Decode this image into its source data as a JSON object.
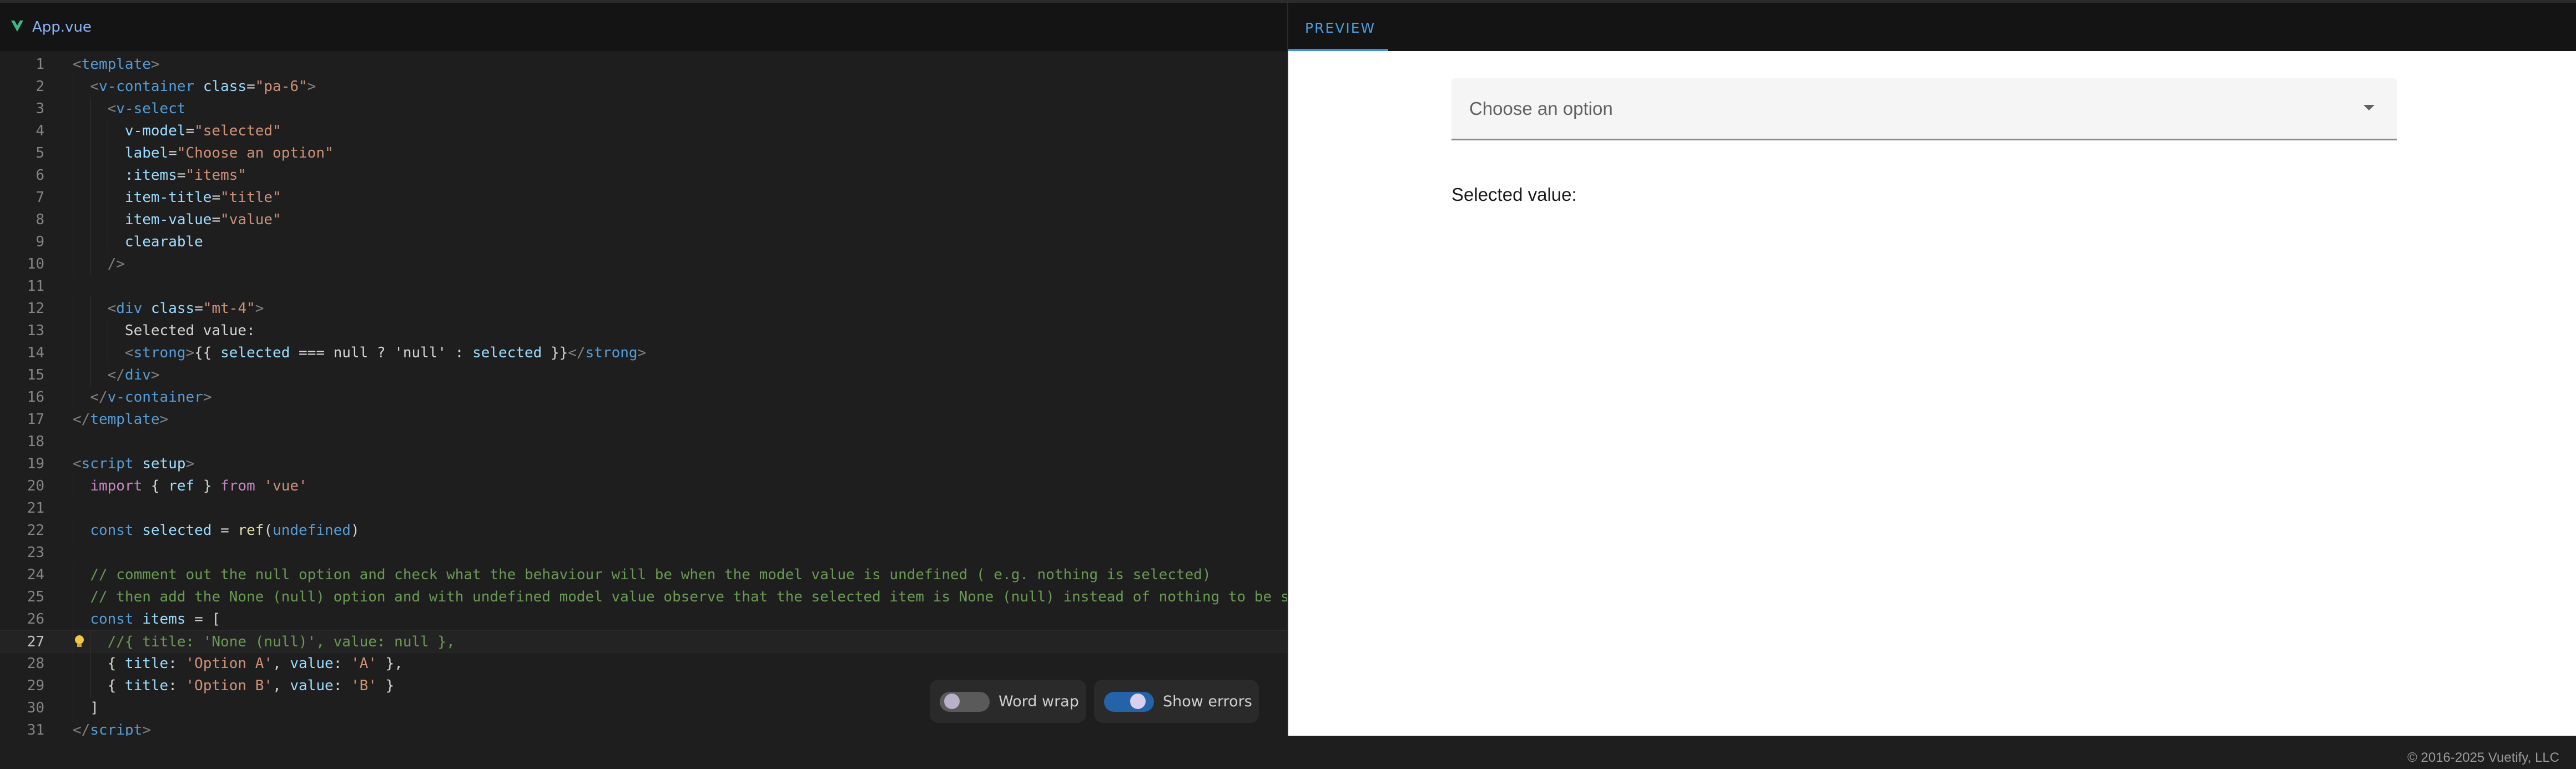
{
  "editor": {
    "file_tab": "App.vue",
    "lines": [
      {
        "n": "1",
        "tokens": [
          [
            "bkt",
            "<"
          ],
          [
            "tag",
            "template"
          ],
          [
            "bkt",
            ">"
          ]
        ]
      },
      {
        "n": "2",
        "tokens": [
          [
            "txt",
            "  "
          ],
          [
            "bkt",
            "<"
          ],
          [
            "tag",
            "v-container"
          ],
          [
            "txt",
            " "
          ],
          [
            "attr",
            "class"
          ],
          [
            "txt",
            "="
          ],
          [
            "str",
            "\"pa-6\""
          ],
          [
            "bkt",
            ">"
          ]
        ]
      },
      {
        "n": "3",
        "tokens": [
          [
            "txt",
            "    "
          ],
          [
            "bkt",
            "<"
          ],
          [
            "tag",
            "v-select"
          ]
        ]
      },
      {
        "n": "4",
        "tokens": [
          [
            "txt",
            "      "
          ],
          [
            "attr",
            "v-model"
          ],
          [
            "txt",
            "="
          ],
          [
            "str",
            "\"selected\""
          ]
        ]
      },
      {
        "n": "5",
        "tokens": [
          [
            "txt",
            "      "
          ],
          [
            "attr",
            "label"
          ],
          [
            "txt",
            "="
          ],
          [
            "str",
            "\"Choose an option\""
          ]
        ]
      },
      {
        "n": "6",
        "tokens": [
          [
            "txt",
            "      "
          ],
          [
            "attr",
            ":items"
          ],
          [
            "txt",
            "="
          ],
          [
            "str",
            "\"items\""
          ]
        ]
      },
      {
        "n": "7",
        "tokens": [
          [
            "txt",
            "      "
          ],
          [
            "attr",
            "item-title"
          ],
          [
            "txt",
            "="
          ],
          [
            "str",
            "\"title\""
          ]
        ]
      },
      {
        "n": "8",
        "tokens": [
          [
            "txt",
            "      "
          ],
          [
            "attr",
            "item-value"
          ],
          [
            "txt",
            "="
          ],
          [
            "str",
            "\"value\""
          ]
        ]
      },
      {
        "n": "9",
        "tokens": [
          [
            "txt",
            "      "
          ],
          [
            "attr",
            "clearable"
          ]
        ]
      },
      {
        "n": "10",
        "tokens": [
          [
            "txt",
            "    "
          ],
          [
            "bkt",
            "/>"
          ]
        ]
      },
      {
        "n": "11",
        "tokens": []
      },
      {
        "n": "12",
        "tokens": [
          [
            "txt",
            "    "
          ],
          [
            "bkt",
            "<"
          ],
          [
            "tag",
            "div"
          ],
          [
            "txt",
            " "
          ],
          [
            "attr",
            "class"
          ],
          [
            "txt",
            "="
          ],
          [
            "str",
            "\"mt-4\""
          ],
          [
            "bkt",
            ">"
          ]
        ]
      },
      {
        "n": "13",
        "tokens": [
          [
            "txt",
            "      Selected value:"
          ]
        ]
      },
      {
        "n": "14",
        "tokens": [
          [
            "txt",
            "      "
          ],
          [
            "bkt",
            "<"
          ],
          [
            "tag",
            "strong"
          ],
          [
            "bkt",
            ">"
          ],
          [
            "txt",
            "{{ "
          ],
          [
            "var",
            "selected"
          ],
          [
            "txt",
            " === null ? 'null' : "
          ],
          [
            "var",
            "selected"
          ],
          [
            "txt",
            " }}"
          ],
          [
            "bkt",
            "</"
          ],
          [
            "tag",
            "strong"
          ],
          [
            "bkt",
            ">"
          ]
        ]
      },
      {
        "n": "15",
        "tokens": [
          [
            "txt",
            "    "
          ],
          [
            "bkt",
            "</"
          ],
          [
            "tag",
            "div"
          ],
          [
            "bkt",
            ">"
          ]
        ]
      },
      {
        "n": "16",
        "tokens": [
          [
            "txt",
            "  "
          ],
          [
            "bkt",
            "</"
          ],
          [
            "tag",
            "v-container"
          ],
          [
            "bkt",
            ">"
          ]
        ]
      },
      {
        "n": "17",
        "tokens": [
          [
            "bkt",
            "</"
          ],
          [
            "tag",
            "template"
          ],
          [
            "bkt",
            ">"
          ]
        ]
      },
      {
        "n": "18",
        "tokens": []
      },
      {
        "n": "19",
        "tokens": [
          [
            "bkt",
            "<"
          ],
          [
            "tag",
            "script"
          ],
          [
            "txt",
            " "
          ],
          [
            "attr",
            "setup"
          ],
          [
            "bkt",
            ">"
          ]
        ]
      },
      {
        "n": "20",
        "tokens": [
          [
            "txt",
            "  "
          ],
          [
            "kw",
            "import"
          ],
          [
            "txt",
            " { "
          ],
          [
            "var",
            "ref"
          ],
          [
            "txt",
            " } "
          ],
          [
            "kw",
            "from"
          ],
          [
            "txt",
            " "
          ],
          [
            "str",
            "'vue'"
          ]
        ]
      },
      {
        "n": "21",
        "tokens": []
      },
      {
        "n": "22",
        "tokens": [
          [
            "txt",
            "  "
          ],
          [
            "kw2",
            "const"
          ],
          [
            "txt",
            " "
          ],
          [
            "var",
            "selected"
          ],
          [
            "txt",
            " = "
          ],
          [
            "fn",
            "ref"
          ],
          [
            "txt",
            "("
          ],
          [
            "kw2",
            "undefined"
          ],
          [
            "txt",
            ")"
          ]
        ]
      },
      {
        "n": "23",
        "tokens": []
      },
      {
        "n": "24",
        "tokens": [
          [
            "txt",
            "  "
          ],
          [
            "cmt",
            "// comment out the null option and check what the behaviour will be when the model value is undefined ( e.g. nothing is selected)"
          ]
        ]
      },
      {
        "n": "25",
        "tokens": [
          [
            "txt",
            "  "
          ],
          [
            "cmt",
            "// then add the None (null) option and with undefined model value observe that the selected item is None (null) instead of nothing to be s"
          ]
        ]
      },
      {
        "n": "26",
        "tokens": [
          [
            "txt",
            "  "
          ],
          [
            "kw2",
            "const"
          ],
          [
            "txt",
            " "
          ],
          [
            "var",
            "items"
          ],
          [
            "txt",
            " = ["
          ]
        ]
      },
      {
        "n": "27",
        "tokens": [
          [
            "txt",
            "    "
          ],
          [
            "cmt",
            "//{ title: 'None (null)', value: null },"
          ]
        ]
      },
      {
        "n": "28",
        "tokens": [
          [
            "txt",
            "    { "
          ],
          [
            "var",
            "title"
          ],
          [
            "txt",
            ": "
          ],
          [
            "str",
            "'Option A'"
          ],
          [
            "txt",
            ", "
          ],
          [
            "var",
            "value"
          ],
          [
            "txt",
            ": "
          ],
          [
            "str",
            "'A'"
          ],
          [
            "txt",
            " },"
          ]
        ]
      },
      {
        "n": "29",
        "tokens": [
          [
            "txt",
            "    { "
          ],
          [
            "var",
            "title"
          ],
          [
            "txt",
            ": "
          ],
          [
            "str",
            "'Option B'"
          ],
          [
            "txt",
            ", "
          ],
          [
            "var",
            "value"
          ],
          [
            "txt",
            ": "
          ],
          [
            "str",
            "'B'"
          ],
          [
            "txt",
            " }"
          ]
        ]
      },
      {
        "n": "30",
        "tokens": [
          [
            "txt",
            "  ]"
          ]
        ]
      },
      {
        "n": "31",
        "tokens": [
          [
            "bkt",
            "</"
          ],
          [
            "tag",
            "script"
          ],
          [
            "bkt",
            ">"
          ]
        ]
      }
    ],
    "active_line": "27",
    "word_wrap": {
      "label": "Word wrap",
      "on": false
    },
    "show_errors": {
      "label": "Show errors",
      "on": true
    }
  },
  "preview": {
    "tab_label": "PREVIEW",
    "select_label": "Choose an option",
    "selected_label": "Selected value:",
    "selected_value": ""
  },
  "footer": {
    "copyright": "© 2016-2025 Vuetify, LLC"
  },
  "colors": {
    "accent": "#3f8fe0",
    "toggle_on": "#2563a8",
    "toggle_off": "#5a5a5a"
  }
}
